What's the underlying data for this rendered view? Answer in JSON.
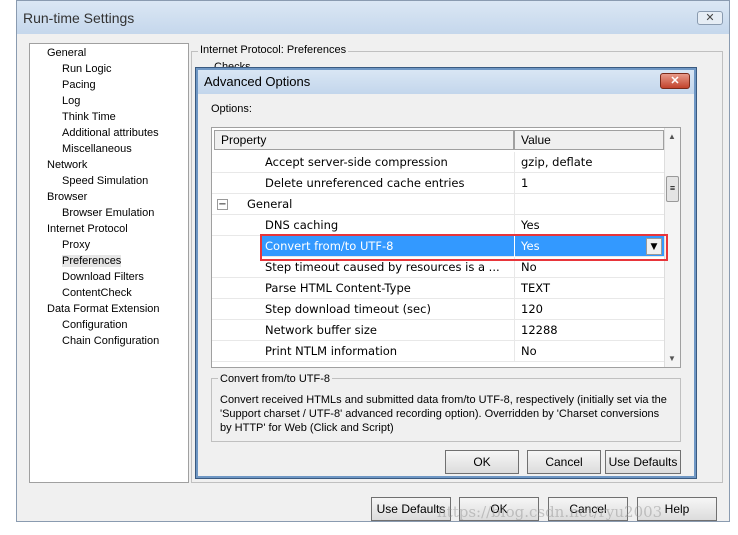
{
  "window": {
    "title": "Run-time Settings",
    "close_label": "✕"
  },
  "tree": [
    {
      "label": "General",
      "level": 0
    },
    {
      "label": "Run Logic",
      "level": 1
    },
    {
      "label": "Pacing",
      "level": 1
    },
    {
      "label": "Log",
      "level": 1
    },
    {
      "label": "Think Time",
      "level": 1
    },
    {
      "label": "Additional attributes",
      "level": 1
    },
    {
      "label": "Miscellaneous",
      "level": 1
    },
    {
      "label": "Network",
      "level": 0
    },
    {
      "label": "Speed Simulation",
      "level": 1
    },
    {
      "label": "Browser",
      "level": 0
    },
    {
      "label": "Browser Emulation",
      "level": 1
    },
    {
      "label": "Internet Protocol",
      "level": 0
    },
    {
      "label": "Proxy",
      "level": 1
    },
    {
      "label": "Preferences",
      "level": 1,
      "selected": true
    },
    {
      "label": "Download Filters",
      "level": 1
    },
    {
      "label": "ContentCheck",
      "level": 1
    },
    {
      "label": "Data Format Extension",
      "level": 0
    },
    {
      "label": "Configuration",
      "level": 1
    },
    {
      "label": "Chain Configuration",
      "level": 1
    }
  ],
  "panel": {
    "title": "Internet Protocol: Preferences",
    "checks_label": "Checks"
  },
  "dialog": {
    "title": "Advanced Options",
    "close_label": "✕",
    "options_label": "Options:",
    "columns": {
      "property": "Property",
      "value": "Value"
    },
    "rows": [
      {
        "property": "Accept server-side compression",
        "value": "gzip, deflate"
      },
      {
        "property": "Delete unreferenced cache entries",
        "value": "1"
      },
      {
        "property": "General",
        "value": "",
        "group": true,
        "toggle": "−"
      },
      {
        "property": "DNS caching",
        "value": "Yes"
      },
      {
        "property": "Convert from/to UTF-8",
        "value": "Yes",
        "selected": true
      },
      {
        "property": "Step timeout caused by resources is a ...",
        "value": "No"
      },
      {
        "property": "Parse HTML Content-Type",
        "value": "TEXT"
      },
      {
        "property": "Step download timeout (sec)",
        "value": "120"
      },
      {
        "property": "Network buffer size",
        "value": "12288"
      },
      {
        "property": "Print NTLM information",
        "value": "No"
      }
    ],
    "description": {
      "title": "Convert from/to UTF-8",
      "text": "Convert received HTMLs and submitted data from/to UTF-8, respectively (initially set via the 'Support charset / UTF-8' advanced recording option). Overridden by 'Charset conversions by HTTP' for Web (Click and Script)"
    },
    "buttons": {
      "ok": "OK",
      "cancel": "Cancel",
      "defaults": "Use Defaults"
    }
  },
  "buttons": {
    "defaults": "Use Defaults",
    "ok": "OK",
    "cancel": "Cancel",
    "help": "Help"
  },
  "watermark": "https://blog.csdn.net/ryu2003",
  "colors": {
    "selection": "#3399ff",
    "highlight_box": "#e8353a"
  }
}
